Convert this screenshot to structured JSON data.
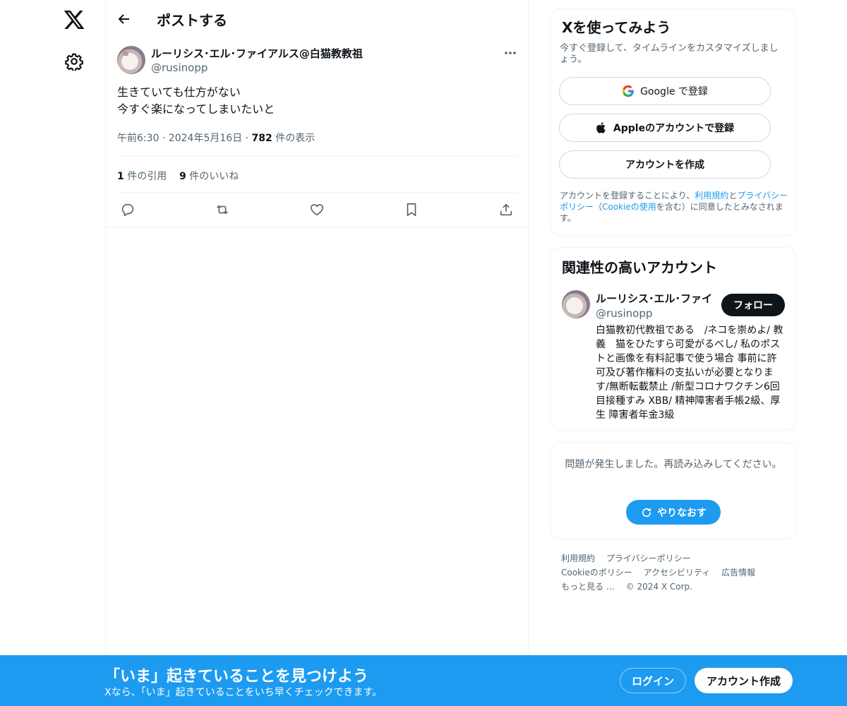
{
  "nav": {
    "logo_icon": "x-logo-icon",
    "settings_icon": "gear-icon"
  },
  "header": {
    "title": "ポストする",
    "back_icon": "arrow-left-icon"
  },
  "post": {
    "author_name": "ルーリシス･エル･ファイアルス@白猫教教祖",
    "author_handle": "@rusinopp",
    "text_line1": "生きていても仕方がない",
    "text_line2": "今すぐ楽になってしまいたいと",
    "time": "午前6:30",
    "date": "2024年5月16日",
    "views_count": "782",
    "views_label": "件の表示",
    "quotes_count": "1",
    "quotes_label": "件の引用",
    "likes_count": "9",
    "likes_label": "件のいいね"
  },
  "signup_card": {
    "title": "Xを使ってみよう",
    "subtitle": "今すぐ登録して、タイムラインをカスタマイズしましょう。",
    "google_label": "Google で登録",
    "apple_label": "Appleのアカウントで登録",
    "create_label": "アカウントを作成",
    "legal_prefix": "アカウントを登録することにより、",
    "terms_link": "利用規約",
    "legal_and": "と",
    "privacy_link": "プライバシーポリシー",
    "legal_mid": "（",
    "cookie_link": "Cookieの使用",
    "legal_suffix": "を含む）に同意したとみなされます。"
  },
  "related": {
    "title": "関連性の高いアカウント",
    "name": "ルーリシス･エル･ファイ",
    "handle": "@rusinopp",
    "follow_label": "フォロー",
    "bio": "白猫教初代教祖である　/ネコを崇めよ/ 教義　猫をひたすら可愛がるべし/ 私のポストと画像を有料記事で使う場合 事前に許可及び著作権料の支払いが必要となります/無断転載禁止 /新型コロナワクチン6回目接種すみ XBB/ 精神障害者手帳2級、厚生 障害者年金3級"
  },
  "error_card": {
    "message": "問題が発生しました。再読み込みしてください。",
    "retry_label": "やりなおす"
  },
  "footer": {
    "terms": "利用規約",
    "privacy": "プライバシーポリシー",
    "cookie": "Cookieのポリシー",
    "accessibility": "アクセシビリティ",
    "ads": "広告情報",
    "more": "もっと見る …",
    "copyright": "© 2024 X Corp."
  },
  "bottom_bar": {
    "title": "「いま」起きていることを見つけよう",
    "subtitle": "Xなら、「いま」起きていることをいち早くチェックできます。",
    "login_label": "ログイン",
    "signup_label": "アカウント作成"
  },
  "colors": {
    "accent": "#1d9bf0",
    "text": "#0f1419",
    "muted": "#536471",
    "border": "#eff3f4"
  }
}
